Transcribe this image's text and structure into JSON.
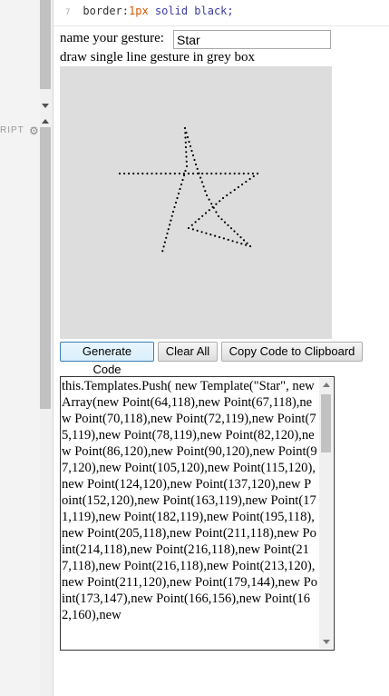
{
  "editor": {
    "code_line_number": "7",
    "code_property": "border:",
    "code_number": "1px",
    "code_value": "solid black;",
    "panel_label": "RIPT"
  },
  "form": {
    "name_label": "name your gesture:",
    "name_value": "Star",
    "draw_instruction": "draw single line gesture in grey box"
  },
  "buttons": {
    "generate": "Generate Code",
    "clear": "Clear All",
    "copy": "Copy Code to Clipboard"
  },
  "output": {
    "code": "this.Templates.Push( new Template(\"Star\", new Array(new Point(64,118),new Point(67,118),new Point(70,118),new Point(72,119),new Point(75,119),new Point(78,119),new Point(82,120),new Point(86,120),new Point(90,120),new Point(97,120),new Point(105,120),new Point(115,120),new Point(124,120),new Point(137,120),new Point(152,120),new Point(163,119),new Point(171,119),new Point(182,119),new Point(195,118),new Point(205,118),new Point(211,118),new Point(214,118),new Point(216,118),new Point(217,118),new Point(216,118),new Point(213,120),new Point(211,120),new Point(179,144),new Point(173,147),new Point(166,156),new Point(162,160),new"
  },
  "colors": {
    "canvas_bg": "#dddddd",
    "stroke": "#000000"
  }
}
